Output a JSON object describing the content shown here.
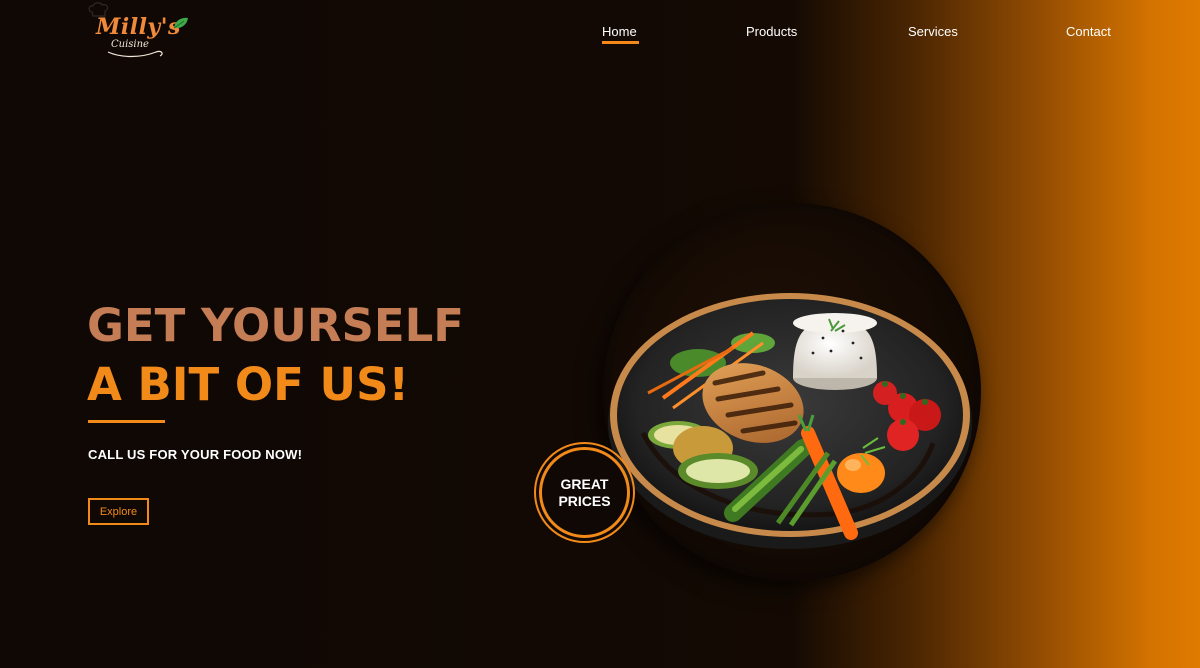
{
  "brand": {
    "name": "Milly's",
    "subtitle": "Cuisine"
  },
  "nav": {
    "items": [
      "Home",
      "Products",
      "Services",
      "Contact"
    ],
    "active": "Home"
  },
  "hero": {
    "line1": "GET YOURSELF",
    "line2": "A BIT OF US!",
    "tagline": "CALL US FOR YOUR FOOD NOW!",
    "cta_label": "Explore"
  },
  "badge": {
    "line1": "GREAT",
    "line2": "PRICES"
  },
  "image": {
    "subject": "plate-of-grilled-chicken-rice-and-vegetables"
  },
  "colors": {
    "accent": "#f28a1a",
    "headline_muted": "#c47d55",
    "background_dark": "#0f0805",
    "gradient_orange": "#e07a00"
  }
}
